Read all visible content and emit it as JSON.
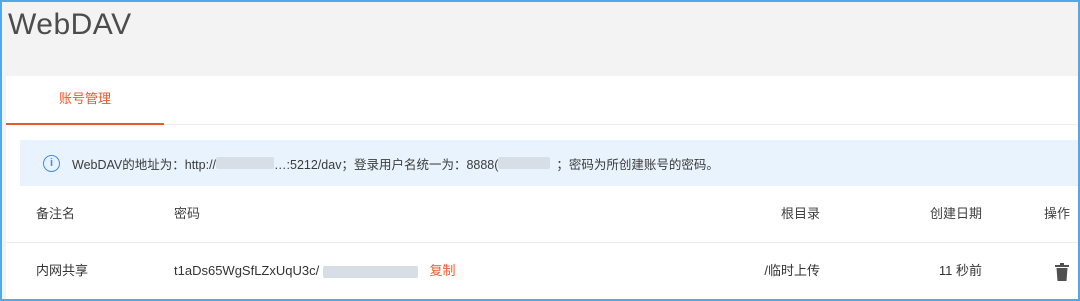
{
  "page": {
    "title": "WebDAV"
  },
  "tabs": [
    {
      "label": "账号管理",
      "active": true
    }
  ],
  "notice": {
    "icon": "info-icon",
    "text_prefix": "WebDAV的地址为：http://",
    "text_addr_visible": "…:5212/dav；登录用户名统一为：8888(",
    "text_suffix": "；密码为所创建账号的密码。"
  },
  "table": {
    "headers": {
      "note": "备注名",
      "password": "密码",
      "root": "根目录",
      "created": "创建日期",
      "actions": "操作"
    },
    "rows": [
      {
        "note": "内网共享",
        "password": "t1aDs65WgSfLZxUqU3c/",
        "copy_label": "复制",
        "root": "/临时上传",
        "created": "11 秒前",
        "action_icon": "trash-icon"
      }
    ]
  },
  "colors": {
    "accent": "#e65a2e",
    "info": "#3d8fe0",
    "notice_bg": "#e9f3fd",
    "frame": "#55a8e8"
  }
}
